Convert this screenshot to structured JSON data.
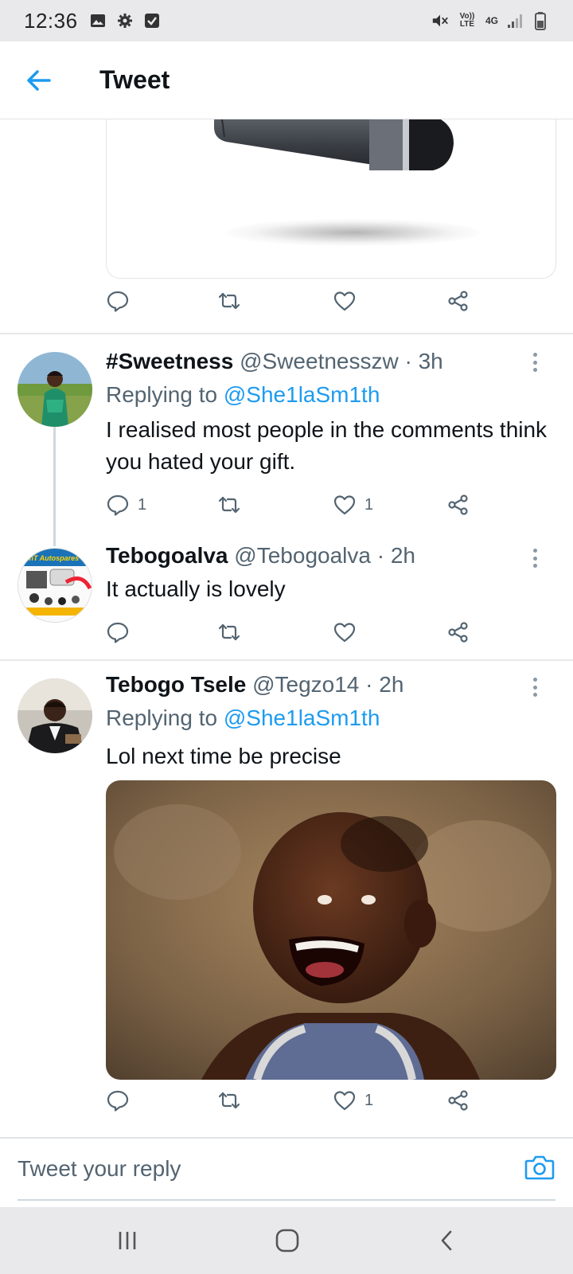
{
  "status_bar": {
    "time": "12:36",
    "left_icons": [
      "image-icon",
      "gear-icon",
      "checkbox-icon"
    ],
    "right_icons": [
      "mute-icon",
      "volte-icon",
      "4g-icon",
      "signal-icon",
      "battery-icon"
    ],
    "volte_label": "Vo)) LTE",
    "network_label": "4G"
  },
  "header": {
    "title": "Tweet",
    "back_icon": "arrow-left-icon"
  },
  "colors": {
    "accent": "#1d9bf0",
    "text_primary": "#0f1419",
    "text_secondary": "#536471",
    "divider": "#e1e4e6"
  },
  "top_tweet": {
    "media_description_icon": "microphone-image",
    "actions": {
      "reply_count": "",
      "retweet_count": "",
      "like_count": ""
    }
  },
  "tweets": [
    {
      "display_name": "#Sweetness",
      "handle": "@Sweetnesszw",
      "time": "3h",
      "replying_label": "Replying to",
      "replying_handle": "@She1laSm1th",
      "text": "I realised most people in the comments think you hated your gift.",
      "reply_count": "1",
      "retweet_count": "",
      "like_count": "1"
    },
    {
      "display_name": "Tebogoalva",
      "handle": "@Tebogoalva",
      "time": "2h",
      "text": "It actually is lovely",
      "reply_count": "",
      "retweet_count": "",
      "like_count": ""
    },
    {
      "display_name": "Tebogo Tsele",
      "handle": "@Tegzo14",
      "time": "2h",
      "replying_label": "Replying to",
      "replying_handle": "@She1laSm1th",
      "text": "Lol next time be precise",
      "reply_count": "",
      "retweet_count": "",
      "like_count": "1"
    }
  ],
  "avatars": {
    "t2_logo_text": "TnT Autospares"
  },
  "reply_bar": {
    "placeholder": "Tweet your reply",
    "camera_icon": "camera-icon"
  },
  "nav_bar": {
    "buttons": [
      "recent-apps-icon",
      "home-icon",
      "back-icon"
    ]
  }
}
